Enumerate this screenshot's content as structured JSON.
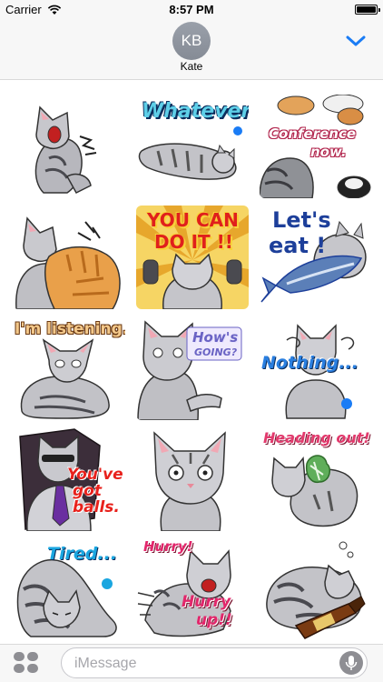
{
  "status_bar": {
    "carrier": "Carrier",
    "time": "8:57 PM",
    "battery_level": 1.0
  },
  "header": {
    "avatar_initials": "KB",
    "contact_name": "Kate"
  },
  "stickers": [
    {
      "name": "yawning-cat",
      "captions": []
    },
    {
      "name": "whatever-cat",
      "captions": [
        "Whatever"
      ]
    },
    {
      "name": "conference-now-cat",
      "captions": [
        "Conference",
        "now."
      ]
    },
    {
      "name": "hugging-cats",
      "captions": []
    },
    {
      "name": "you-can-do-it-cat",
      "captions": [
        "YOU CAN",
        "DO IT !!"
      ]
    },
    {
      "name": "lets-eat-cat",
      "captions": [
        "Let's",
        "eat !"
      ]
    },
    {
      "name": "im-listening-cat",
      "captions": [
        "I'm listening."
      ]
    },
    {
      "name": "hows-going-cat",
      "captions": [
        "How's",
        "GOING?"
      ]
    },
    {
      "name": "nothing-cat",
      "captions": [
        "Nothing..."
      ]
    },
    {
      "name": "youve-got-balls-cat",
      "captions": [
        "You've",
        "got",
        "balls."
      ]
    },
    {
      "name": "staring-cat",
      "captions": []
    },
    {
      "name": "heading-out-cat",
      "captions": [
        "Heading out!"
      ]
    },
    {
      "name": "tired-cat",
      "captions": [
        "Tired..."
      ]
    },
    {
      "name": "hurry-cat",
      "captions": [
        "Hurry!",
        "Hurry",
        "up!!"
      ]
    },
    {
      "name": "sleeping-bottle-cat",
      "captions": []
    }
  ],
  "composer": {
    "placeholder": "iMessage"
  },
  "icons": {
    "wifi": "wifi-icon",
    "battery": "battery-icon",
    "chevron": "chevron-down-icon",
    "apps": "app-drawer-icon",
    "mic": "microphone-icon"
  },
  "colors": {
    "system_blue": "#1a7cf5",
    "avatar_gray": "#8e939d",
    "bar_background": "#f7f7f7"
  }
}
